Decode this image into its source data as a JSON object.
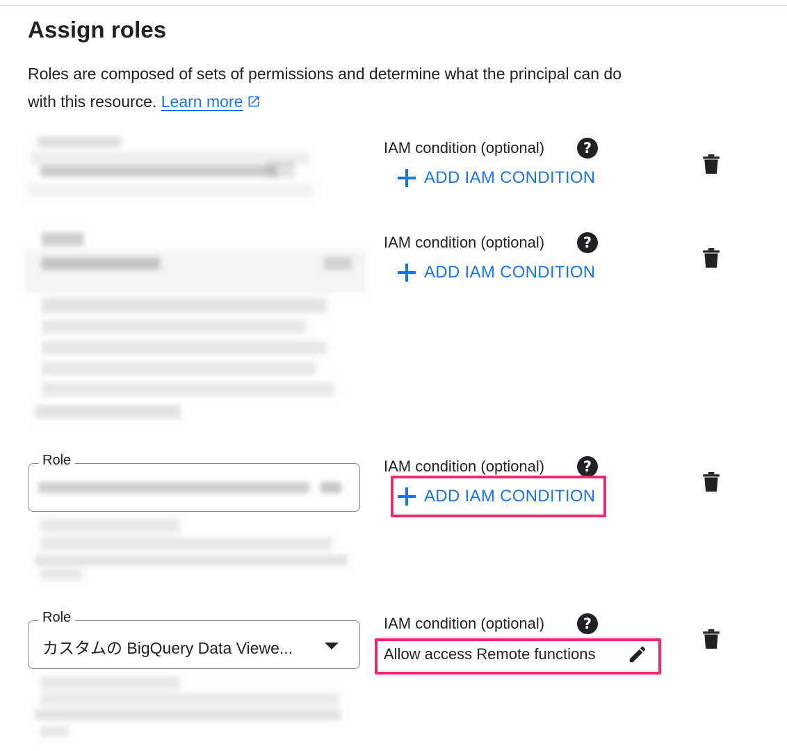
{
  "header": {
    "title": "Assign roles",
    "description_line1": "Roles are composed of sets of permissions and determine what the principal can do",
    "description_line2": "with this resource.",
    "learn_more": "Learn more"
  },
  "rows": [
    {
      "condition_label": "IAM condition (optional)",
      "help": "?",
      "add_condition": "ADD IAM CONDITION"
    },
    {
      "condition_label": "IAM condition (optional)",
      "help": "?",
      "add_condition": "ADD IAM CONDITION"
    },
    {
      "role_label": "Role",
      "condition_label": "IAM condition (optional)",
      "help": "?",
      "add_condition": "ADD IAM CONDITION",
      "highlighted": true
    },
    {
      "role_label": "Role",
      "role_value": "カスタムの BigQuery Data Viewe...",
      "condition_label": "IAM condition (optional)",
      "help": "?",
      "condition_value": "Allow access Remote functions",
      "highlighted": true
    }
  ],
  "colors": {
    "accent": "#1a73e8",
    "highlight": "#ec2a6b",
    "text": "#202124",
    "border": "#80868b"
  },
  "icons": [
    "help-icon",
    "plus-icon",
    "trash-icon",
    "external-link-icon",
    "dropdown-caret-icon",
    "edit-pencil-icon"
  ]
}
